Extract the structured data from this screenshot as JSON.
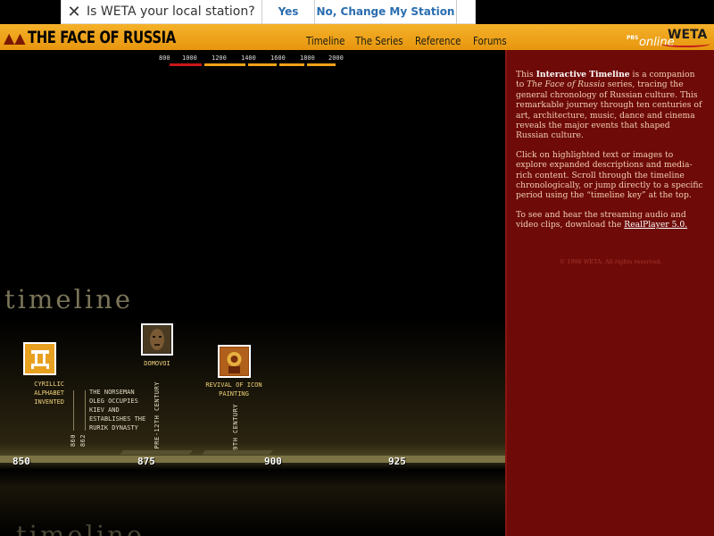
{
  "banner": {
    "question": "Is WETA your local station?",
    "yes_label": "Yes",
    "no_label": "No, Change My Station"
  },
  "header": {
    "logo_text": "THE FACE OF RUSSIA",
    "nav": [
      "Timeline",
      "The Series",
      "Reference",
      "Forums"
    ],
    "pbs": "PBS",
    "online": "online",
    "weta": "WETA"
  },
  "timeline_key": {
    "labels": [
      "800",
      "1000",
      "1200",
      "1400",
      "1600",
      "1800",
      "2000"
    ],
    "colors": {
      "active": "#c81818",
      "inactive": "#f0a018"
    }
  },
  "timeline": {
    "heading": "timeline",
    "heading_repeat": "timeline",
    "years": [
      "850",
      "875",
      "900",
      "925"
    ],
    "events": {
      "cyrillic": "CYRILLIC ALPHABET INVENTED",
      "domovoi": "DOMOVOI",
      "icon_revival": "REVIVAL OF ICON PAINTING"
    },
    "dates": {
      "d860": "860",
      "d862": "862",
      "pre12": "PRE-12TH CENTURY",
      "c9": "9TH CENTURY"
    },
    "note": "THE NORSEMAN OLEG OCCUPIES KIEV AND ESTABLISHES THE RURIK DYNASTY"
  },
  "panel": {
    "p1_a": "This ",
    "p1_b": "Interactive Timeline",
    "p1_c": " is a companion to ",
    "p1_d": "The Face of Russia",
    "p1_e": " series, tracing the general chronology of Russian culture. This remarkable journey through ten centuries of art, architecture, music, dance and cinema reveals the major events that shaped Russian culture.",
    "p2": "Click on highlighted text or images to explore expanded descriptions and media-rich content. Scroll through the timeline chronologically, or jump directly to a specific period using the “timeline key” at the top.",
    "p3_a": "To see and hear the streaming audio and video clips, download the ",
    "p3_link": "RealPlayer 5.0.",
    "copyright": "© 1998 WETA. All rights reserved."
  }
}
